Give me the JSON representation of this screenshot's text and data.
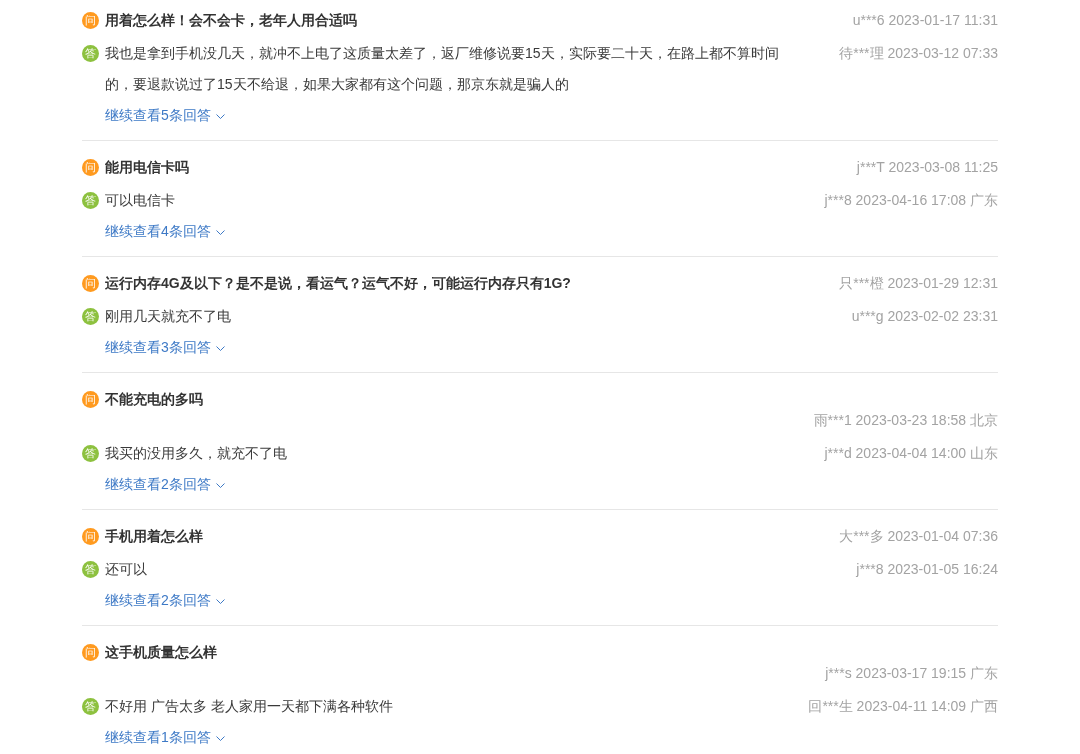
{
  "qa_list": [
    {
      "question": {
        "kind": "inline",
        "badge": "问",
        "text": "用着怎么样！会不会卡，老年人用合适吗",
        "meta": "u***6 2023-01-17 11:31"
      },
      "answer": {
        "badge": "答",
        "text": "我也是拿到手机没几天，就冲不上电了这质量太差了，返厂维修说要15天，实际要二十天，在路上都不算时间的，要退款说过了15天不给退，如果大家都有这个问题，那京东就是骗人的",
        "meta": "待***理 2023-03-12 07:33"
      },
      "more_link": "继续查看5条回答"
    },
    {
      "question": {
        "kind": "inline",
        "badge": "问",
        "text": "能用电信卡吗",
        "meta": "j***T 2023-03-08 11:25"
      },
      "answer": {
        "badge": "答",
        "text": "可以电信卡",
        "meta": "j***8 2023-04-16 17:08 广东"
      },
      "more_link": "继续查看4条回答"
    },
    {
      "question": {
        "kind": "inline",
        "badge": "问",
        "text": "运行内存4G及以下？是不是说，看运气？运气不好，可能运行内存只有1G?",
        "meta": "只***橙 2023-01-29 12:31"
      },
      "answer": {
        "badge": "答",
        "text": "刚用几天就充不了电",
        "meta": "u***g 2023-02-02 23:31"
      },
      "more_link": "继续查看3条回答"
    },
    {
      "question": {
        "kind": "stacked",
        "badge": "问",
        "text": "不能充电的多吗",
        "meta": "雨***1 2023-03-23 18:58 北京"
      },
      "answer": {
        "badge": "答",
        "text": "我买的没用多久，就充不了电",
        "meta": "j***d 2023-04-04 14:00 山东"
      },
      "more_link": "继续查看2条回答"
    },
    {
      "question": {
        "kind": "inline",
        "badge": "问",
        "text": "手机用着怎么样",
        "meta": "大***多 2023-01-04 07:36"
      },
      "answer": {
        "badge": "答",
        "text": "还可以",
        "meta": "j***8 2023-01-05 16:24"
      },
      "more_link": "继续查看2条回答"
    },
    {
      "question": {
        "kind": "stacked",
        "badge": "问",
        "text": "这手机质量怎么样",
        "meta": "j***s 2023-03-17 19:15 广东"
      },
      "answer": {
        "badge": "答",
        "text": "不好用 广告太多 老人家用一天都下满各种软件",
        "meta": "回***生 2023-04-11 14:09 广西"
      },
      "more_link": "继续查看1条回答"
    }
  ]
}
